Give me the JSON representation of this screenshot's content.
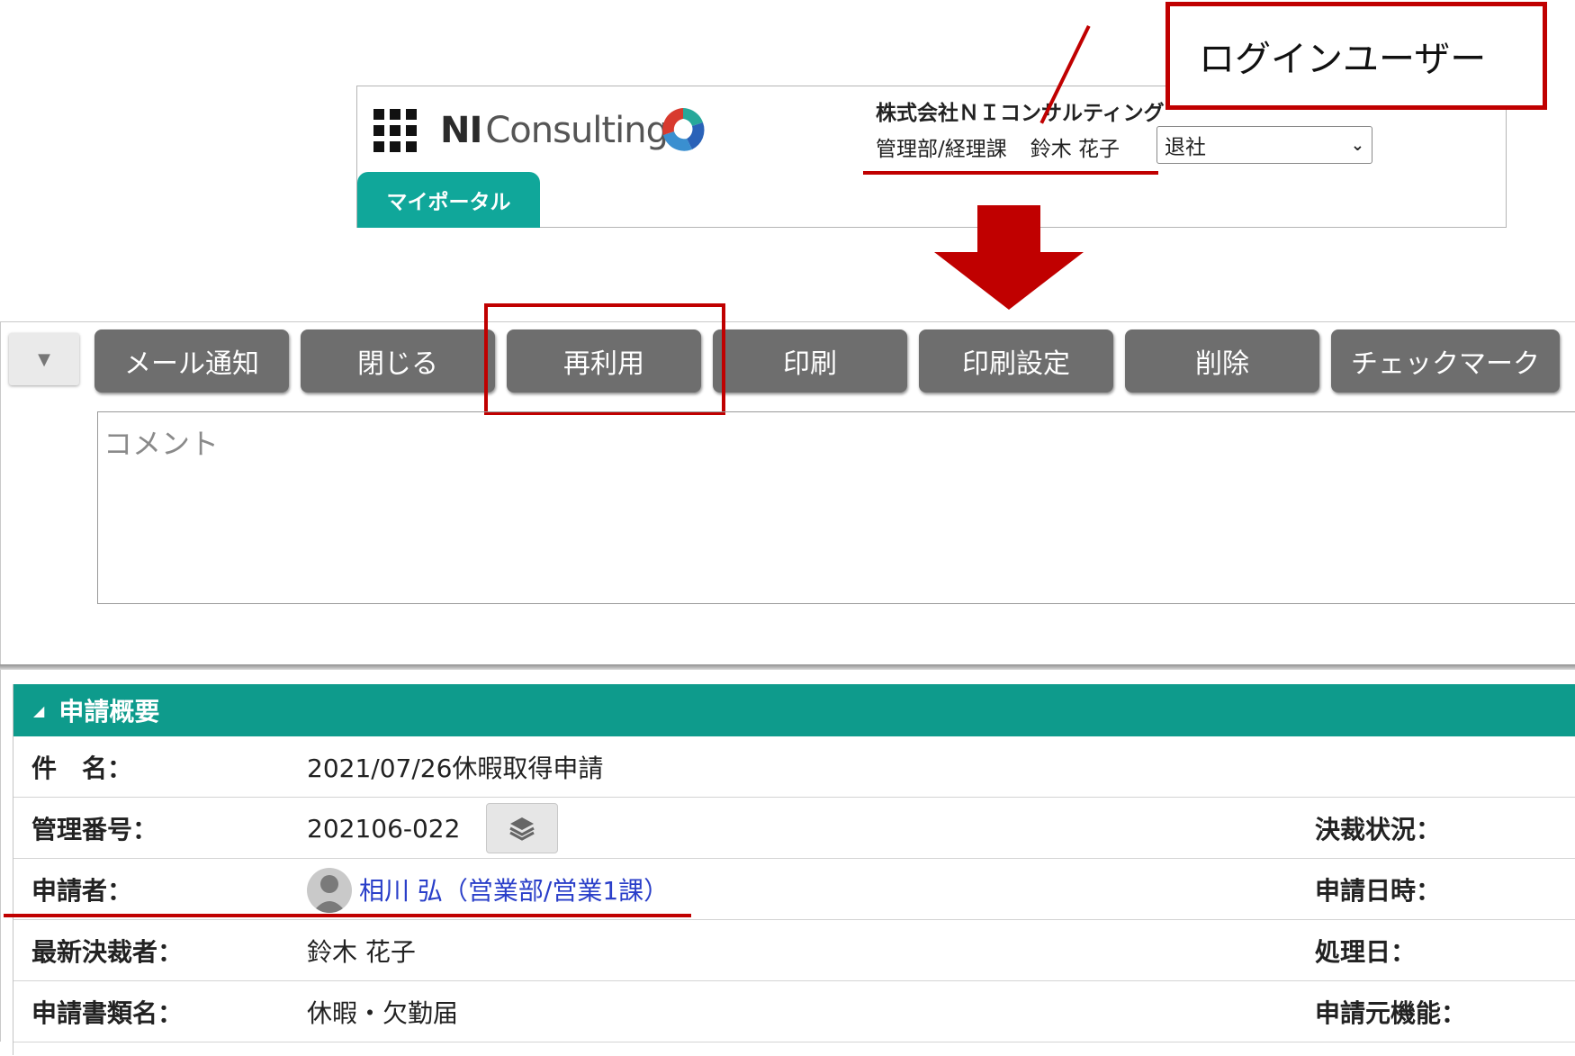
{
  "header": {
    "logo_text_ni": "NI",
    "logo_text_rest": "Consulting",
    "company": "株式会社ＮＩコンサルティング",
    "department": "管理部/経理課",
    "user_name": "鈴木 花子",
    "status_value": "退社",
    "portal_tab": "マイポータル"
  },
  "callout": {
    "label": "ログインユーザー"
  },
  "toolbar": {
    "buttons": [
      "メール通知",
      "閉じる",
      "再利用",
      "印刷",
      "印刷設定",
      "削除",
      "チェックマーク"
    ]
  },
  "comment": {
    "placeholder": "コメント"
  },
  "summary": {
    "title": "申請概要",
    "rows": [
      {
        "label": "件　名：",
        "value": "2021/07/26休暇取得申請",
        "right_label": ""
      },
      {
        "label": "管理番号：",
        "value": "202106-022",
        "right_label": "決裁状況："
      },
      {
        "label": "申請者：",
        "value": "相川 弘（営業部/営業1課）",
        "right_label": "申請日時："
      },
      {
        "label": "最新決裁者：",
        "value": "鈴木 花子",
        "right_label": "処理日："
      },
      {
        "label": "申請書類名：",
        "value": "休暇・欠勤届",
        "right_label": "申請元機能："
      }
    ]
  },
  "colors": {
    "accent_teal": "#0e9b8c",
    "annotation_red": "#c00000",
    "toolbar_gray": "#6e6e6e",
    "link_blue": "#2a3fc9"
  }
}
